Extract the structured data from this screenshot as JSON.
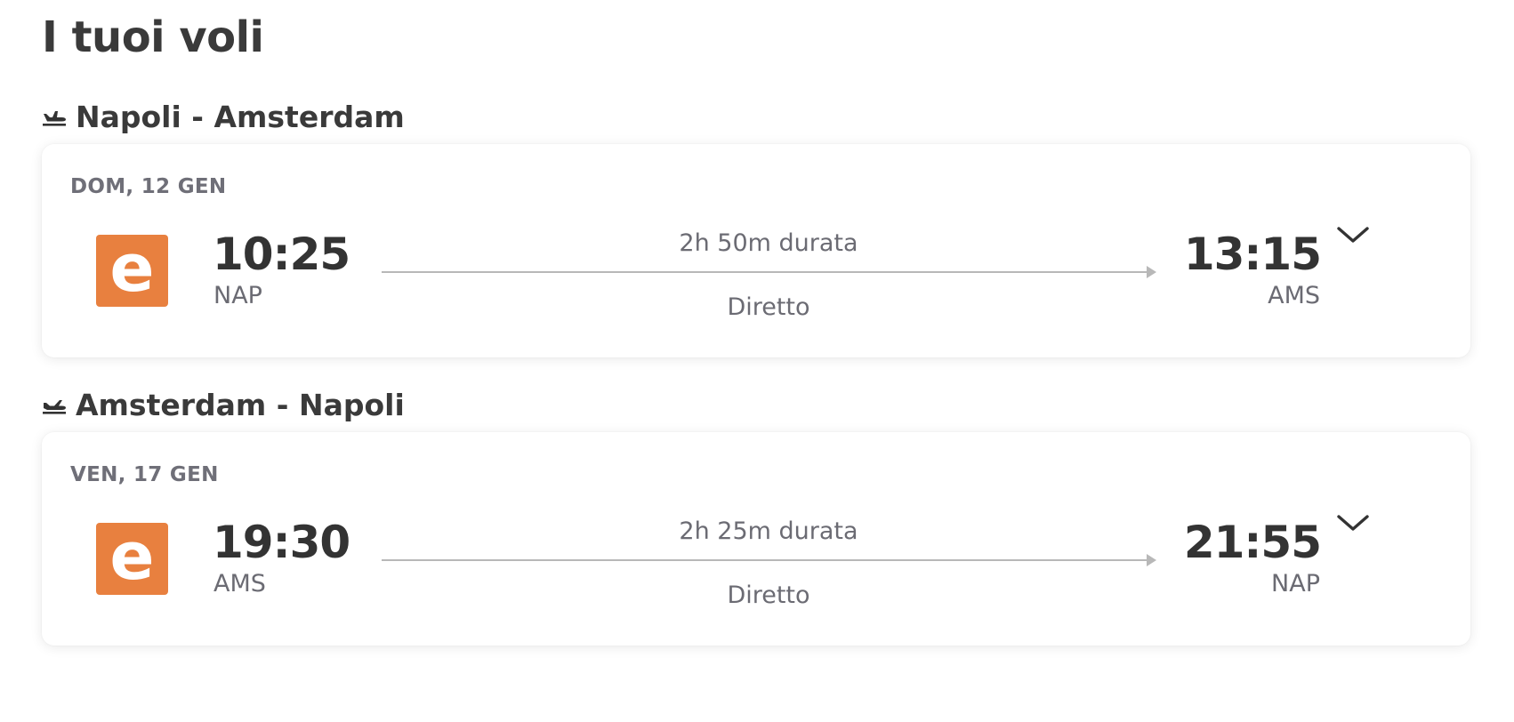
{
  "page_title": "I tuoi voli",
  "colors": {
    "airline_logo": "#e8803f",
    "text_dark": "#333333",
    "text_muted": "#6b6b73"
  },
  "legs": [
    {
      "heading": "Napoli - Amsterdam",
      "heading_icon": "plane-takeoff-icon",
      "date": "DOM, 12 GEN",
      "airline_logo_letter": "e",
      "departure": {
        "time": "10:25",
        "code": "NAP"
      },
      "arrival": {
        "time": "13:15",
        "code": "AMS"
      },
      "duration": "2h 50m durata",
      "stops": "Diretto",
      "expand_icon": "chevron-down-icon"
    },
    {
      "heading": "Amsterdam - Napoli",
      "heading_icon": "plane-landing-icon",
      "date": "VEN, 17 GEN",
      "airline_logo_letter": "e",
      "departure": {
        "time": "19:30",
        "code": "AMS"
      },
      "arrival": {
        "time": "21:55",
        "code": "NAP"
      },
      "duration": "2h 25m durata",
      "stops": "Diretto",
      "expand_icon": "chevron-down-icon"
    }
  ]
}
